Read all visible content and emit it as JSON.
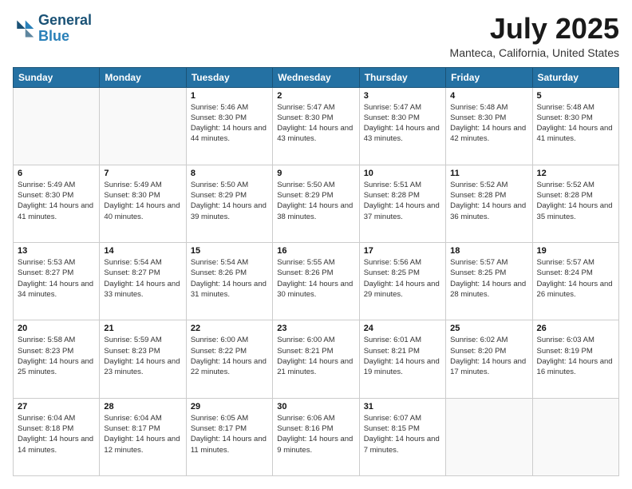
{
  "header": {
    "logo_line1": "General",
    "logo_line2": "Blue",
    "month": "July 2025",
    "location": "Manteca, California, United States"
  },
  "weekdays": [
    "Sunday",
    "Monday",
    "Tuesday",
    "Wednesday",
    "Thursday",
    "Friday",
    "Saturday"
  ],
  "weeks": [
    [
      {
        "day": "",
        "sunrise": "",
        "sunset": "",
        "daylight": ""
      },
      {
        "day": "",
        "sunrise": "",
        "sunset": "",
        "daylight": ""
      },
      {
        "day": "1",
        "sunrise": "Sunrise: 5:46 AM",
        "sunset": "Sunset: 8:30 PM",
        "daylight": "Daylight: 14 hours and 44 minutes."
      },
      {
        "day": "2",
        "sunrise": "Sunrise: 5:47 AM",
        "sunset": "Sunset: 8:30 PM",
        "daylight": "Daylight: 14 hours and 43 minutes."
      },
      {
        "day": "3",
        "sunrise": "Sunrise: 5:47 AM",
        "sunset": "Sunset: 8:30 PM",
        "daylight": "Daylight: 14 hours and 43 minutes."
      },
      {
        "day": "4",
        "sunrise": "Sunrise: 5:48 AM",
        "sunset": "Sunset: 8:30 PM",
        "daylight": "Daylight: 14 hours and 42 minutes."
      },
      {
        "day": "5",
        "sunrise": "Sunrise: 5:48 AM",
        "sunset": "Sunset: 8:30 PM",
        "daylight": "Daylight: 14 hours and 41 minutes."
      }
    ],
    [
      {
        "day": "6",
        "sunrise": "Sunrise: 5:49 AM",
        "sunset": "Sunset: 8:30 PM",
        "daylight": "Daylight: 14 hours and 41 minutes."
      },
      {
        "day": "7",
        "sunrise": "Sunrise: 5:49 AM",
        "sunset": "Sunset: 8:30 PM",
        "daylight": "Daylight: 14 hours and 40 minutes."
      },
      {
        "day": "8",
        "sunrise": "Sunrise: 5:50 AM",
        "sunset": "Sunset: 8:29 PM",
        "daylight": "Daylight: 14 hours and 39 minutes."
      },
      {
        "day": "9",
        "sunrise": "Sunrise: 5:50 AM",
        "sunset": "Sunset: 8:29 PM",
        "daylight": "Daylight: 14 hours and 38 minutes."
      },
      {
        "day": "10",
        "sunrise": "Sunrise: 5:51 AM",
        "sunset": "Sunset: 8:28 PM",
        "daylight": "Daylight: 14 hours and 37 minutes."
      },
      {
        "day": "11",
        "sunrise": "Sunrise: 5:52 AM",
        "sunset": "Sunset: 8:28 PM",
        "daylight": "Daylight: 14 hours and 36 minutes."
      },
      {
        "day": "12",
        "sunrise": "Sunrise: 5:52 AM",
        "sunset": "Sunset: 8:28 PM",
        "daylight": "Daylight: 14 hours and 35 minutes."
      }
    ],
    [
      {
        "day": "13",
        "sunrise": "Sunrise: 5:53 AM",
        "sunset": "Sunset: 8:27 PM",
        "daylight": "Daylight: 14 hours and 34 minutes."
      },
      {
        "day": "14",
        "sunrise": "Sunrise: 5:54 AM",
        "sunset": "Sunset: 8:27 PM",
        "daylight": "Daylight: 14 hours and 33 minutes."
      },
      {
        "day": "15",
        "sunrise": "Sunrise: 5:54 AM",
        "sunset": "Sunset: 8:26 PM",
        "daylight": "Daylight: 14 hours and 31 minutes."
      },
      {
        "day": "16",
        "sunrise": "Sunrise: 5:55 AM",
        "sunset": "Sunset: 8:26 PM",
        "daylight": "Daylight: 14 hours and 30 minutes."
      },
      {
        "day": "17",
        "sunrise": "Sunrise: 5:56 AM",
        "sunset": "Sunset: 8:25 PM",
        "daylight": "Daylight: 14 hours and 29 minutes."
      },
      {
        "day": "18",
        "sunrise": "Sunrise: 5:57 AM",
        "sunset": "Sunset: 8:25 PM",
        "daylight": "Daylight: 14 hours and 28 minutes."
      },
      {
        "day": "19",
        "sunrise": "Sunrise: 5:57 AM",
        "sunset": "Sunset: 8:24 PM",
        "daylight": "Daylight: 14 hours and 26 minutes."
      }
    ],
    [
      {
        "day": "20",
        "sunrise": "Sunrise: 5:58 AM",
        "sunset": "Sunset: 8:23 PM",
        "daylight": "Daylight: 14 hours and 25 minutes."
      },
      {
        "day": "21",
        "sunrise": "Sunrise: 5:59 AM",
        "sunset": "Sunset: 8:23 PM",
        "daylight": "Daylight: 14 hours and 23 minutes."
      },
      {
        "day": "22",
        "sunrise": "Sunrise: 6:00 AM",
        "sunset": "Sunset: 8:22 PM",
        "daylight": "Daylight: 14 hours and 22 minutes."
      },
      {
        "day": "23",
        "sunrise": "Sunrise: 6:00 AM",
        "sunset": "Sunset: 8:21 PM",
        "daylight": "Daylight: 14 hours and 21 minutes."
      },
      {
        "day": "24",
        "sunrise": "Sunrise: 6:01 AM",
        "sunset": "Sunset: 8:21 PM",
        "daylight": "Daylight: 14 hours and 19 minutes."
      },
      {
        "day": "25",
        "sunrise": "Sunrise: 6:02 AM",
        "sunset": "Sunset: 8:20 PM",
        "daylight": "Daylight: 14 hours and 17 minutes."
      },
      {
        "day": "26",
        "sunrise": "Sunrise: 6:03 AM",
        "sunset": "Sunset: 8:19 PM",
        "daylight": "Daylight: 14 hours and 16 minutes."
      }
    ],
    [
      {
        "day": "27",
        "sunrise": "Sunrise: 6:04 AM",
        "sunset": "Sunset: 8:18 PM",
        "daylight": "Daylight: 14 hours and 14 minutes."
      },
      {
        "day": "28",
        "sunrise": "Sunrise: 6:04 AM",
        "sunset": "Sunset: 8:17 PM",
        "daylight": "Daylight: 14 hours and 12 minutes."
      },
      {
        "day": "29",
        "sunrise": "Sunrise: 6:05 AM",
        "sunset": "Sunset: 8:17 PM",
        "daylight": "Daylight: 14 hours and 11 minutes."
      },
      {
        "day": "30",
        "sunrise": "Sunrise: 6:06 AM",
        "sunset": "Sunset: 8:16 PM",
        "daylight": "Daylight: 14 hours and 9 minutes."
      },
      {
        "day": "31",
        "sunrise": "Sunrise: 6:07 AM",
        "sunset": "Sunset: 8:15 PM",
        "daylight": "Daylight: 14 hours and 7 minutes."
      },
      {
        "day": "",
        "sunrise": "",
        "sunset": "",
        "daylight": ""
      },
      {
        "day": "",
        "sunrise": "",
        "sunset": "",
        "daylight": ""
      }
    ]
  ]
}
